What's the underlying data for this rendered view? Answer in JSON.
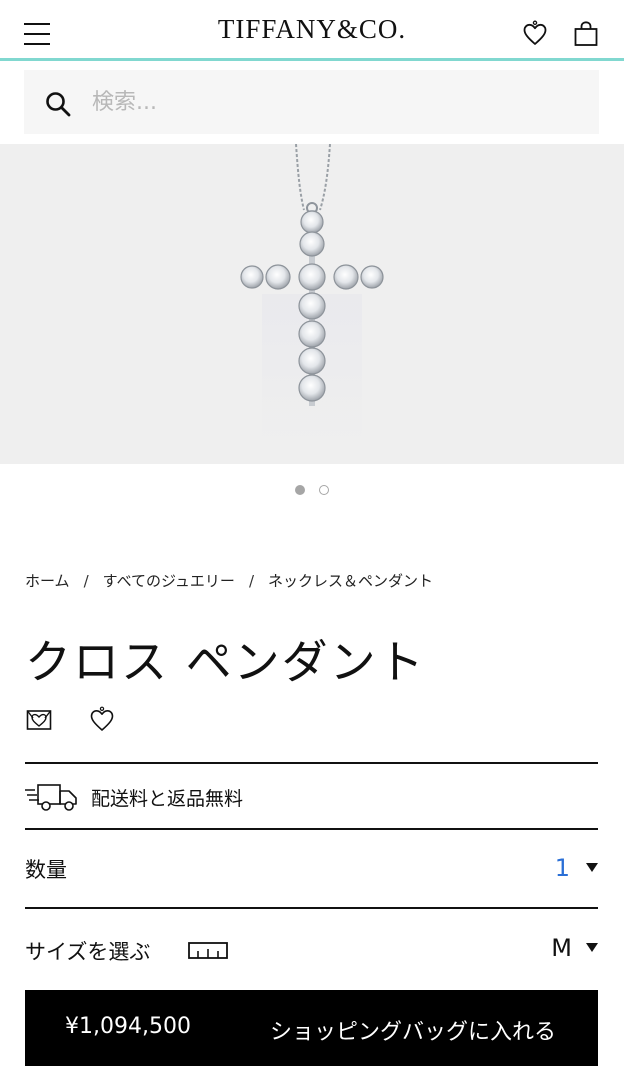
{
  "header": {
    "brand": "TIFFANY&CO."
  },
  "search": {
    "placeholder": "検索..."
  },
  "gallery": {
    "image_alt": "クロス ペンダント",
    "slide_count": 2,
    "active_slide": 1
  },
  "breadcrumb": {
    "items": [
      "ホーム",
      "すべてのジュエリー",
      "ネックレス＆ペンダント"
    ],
    "separator": "/"
  },
  "product": {
    "title": "クロス ペンダント"
  },
  "shipping": {
    "text": "配送料と返品無料"
  },
  "quantity": {
    "label": "数量",
    "value": "1"
  },
  "size": {
    "label": "サイズを選ぶ",
    "value": "M"
  },
  "cta": {
    "price": "¥1,094,500",
    "label": "ショッピングバッグに入れる"
  },
  "colors": {
    "brand_accent": "#81d8d0",
    "quantity_value": "#2a6fd6",
    "cta_background": "#000000"
  },
  "icons": [
    "menu-icon",
    "heart-icon",
    "shopping-bag-icon",
    "search-icon",
    "email-icon",
    "heart-icon",
    "delivery-truck-icon",
    "ruler-icon",
    "chevron-down-icon"
  ]
}
